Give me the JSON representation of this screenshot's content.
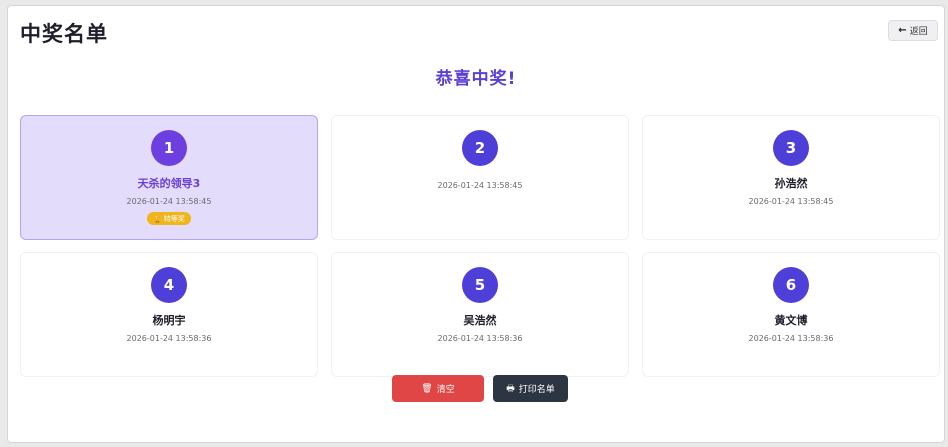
{
  "header": {
    "title": "中奖名单",
    "back_label": "返回"
  },
  "congrats_text": "恭喜中奖!",
  "winners": [
    {
      "rank": "1",
      "name": "天杀的领导3",
      "time": "2026-01-24 13:58:45",
      "badge": "特等奖"
    },
    {
      "rank": "2",
      "name": "",
      "time": "2026-01-24 13:58:45"
    },
    {
      "rank": "3",
      "name": "孙浩然",
      "time": "2026-01-24 13:58:45"
    },
    {
      "rank": "4",
      "name": "杨明宇",
      "time": "2026-01-24 13:58:36"
    },
    {
      "rank": "5",
      "name": "吴浩然",
      "time": "2026-01-24 13:58:36"
    },
    {
      "rank": "6",
      "name": "黄文博",
      "time": "2026-01-24 13:58:36"
    }
  ],
  "actions": {
    "clear_label": "清空",
    "print_label": "打印名单"
  },
  "colors": {
    "accent": "#5b3fd6",
    "badge": "#f1b51c",
    "danger": "#e04646",
    "dark": "#2c3542"
  },
  "icons": {
    "back": "arrow-left-icon",
    "trophy": "trophy-icon",
    "trash": "trash-icon",
    "print": "printer-icon"
  }
}
